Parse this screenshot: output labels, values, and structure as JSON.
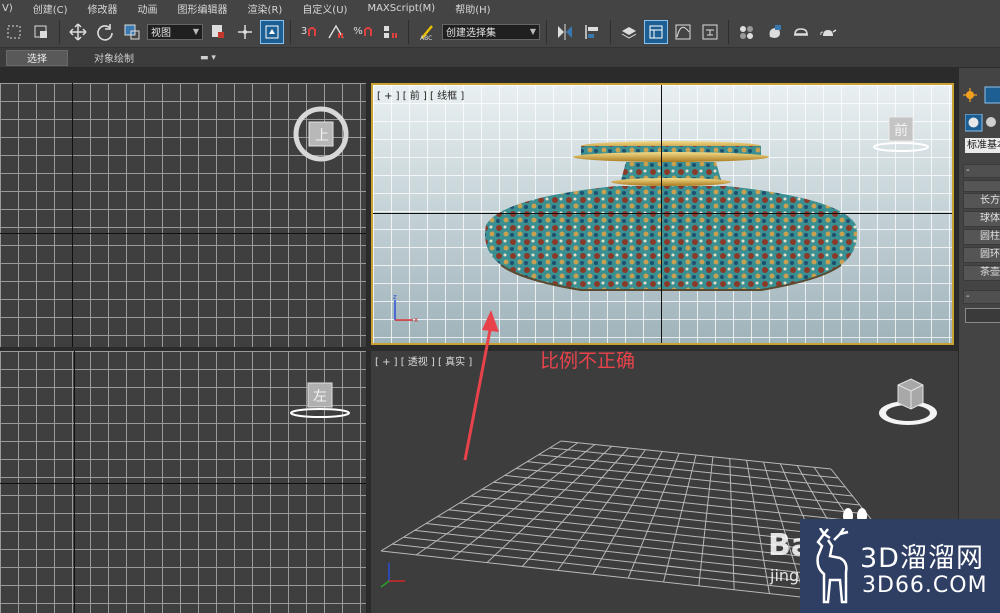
{
  "menu": [
    "V)",
    "创建(C)",
    "修改器",
    "动画",
    "图形编辑器",
    "渲染(R)",
    "自定义(U)",
    "MAXScript(M)",
    "帮助(H)"
  ],
  "toolbar": {
    "view_dropdown": "视图",
    "spinner_snap": "3",
    "percent_snap": "%",
    "selection_set": "创建选择集",
    "icons": [
      "select-icon",
      "move-icon",
      "rotate-icon",
      "pivot-icon",
      "snap-icon",
      "mirror-icon",
      "align-icon",
      "layer-icon",
      "curve-editor-icon",
      "material-icon",
      "render-setup-icon",
      "render-icon",
      "teapot-icon"
    ]
  },
  "ribbon": {
    "tabs": [
      "选择",
      "对象绘制"
    ],
    "active_tab": "选择"
  },
  "viewports": {
    "top": {
      "cube_label": "上"
    },
    "front": {
      "label": "[ + ] [ 前 ] [ 线框 ]",
      "cube_label": "前"
    },
    "left": {
      "cube_label": "左"
    },
    "perspective": {
      "label": "[ + ] [ 透视 ] [ 真实 ]"
    }
  },
  "command_panel": {
    "dropdown": "标准基本",
    "rollout_1": "-",
    "buttons": [
      "长方",
      "球体",
      "圆柱",
      "圆环",
      "茶壶"
    ],
    "rollout_2": "-"
  },
  "annotation": {
    "text": "比例不正确",
    "color": "#e8434b"
  },
  "watermark": {
    "site": "3D溜溜网",
    "domain": "3D66.COM",
    "baidu": "Bai",
    "baidu_sub": "jing"
  },
  "colors": {
    "active_viewport_border": "#c9a233",
    "active_tool": "#1d5f93",
    "watermark_bg": "#2f3e63"
  }
}
